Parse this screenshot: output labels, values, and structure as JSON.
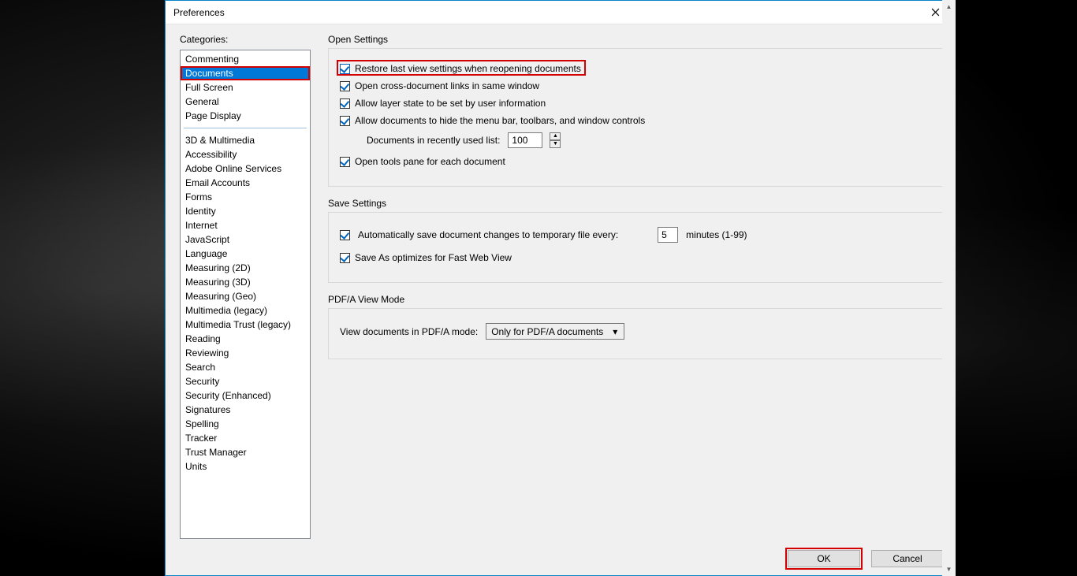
{
  "window": {
    "title": "Preferences"
  },
  "sidebar": {
    "label": "Categories:",
    "groups": [
      [
        "Commenting",
        "Documents",
        "Full Screen",
        "General",
        "Page Display"
      ],
      [
        "3D & Multimedia",
        "Accessibility",
        "Adobe Online Services",
        "Email Accounts",
        "Forms",
        "Identity",
        "Internet",
        "JavaScript",
        "Language",
        "Measuring (2D)",
        "Measuring (3D)",
        "Measuring (Geo)",
        "Multimedia (legacy)",
        "Multimedia Trust (legacy)",
        "Reading",
        "Reviewing",
        "Search",
        "Security",
        "Security (Enhanced)",
        "Signatures",
        "Spelling",
        "Tracker",
        "Trust Manager",
        "Units"
      ]
    ],
    "selected": "Documents"
  },
  "open_settings": {
    "title": "Open Settings",
    "restore_last_view": {
      "label": "Restore last view settings when reopening documents",
      "checked": true,
      "highlight": true
    },
    "cross_doc_links": {
      "label": "Open cross-document links in same window",
      "checked": true
    },
    "layer_state": {
      "label": "Allow layer state to be set by user information",
      "checked": true
    },
    "hide_menubar": {
      "label": "Allow documents to hide the menu bar, toolbars, and window controls",
      "checked": true
    },
    "recent_label": "Documents in recently used list:",
    "recent_value": "100",
    "tools_pane": {
      "label": "Open tools pane for each document",
      "checked": true
    }
  },
  "save_settings": {
    "title": "Save Settings",
    "autosave": {
      "label": "Automatically save document changes to temporary file every:",
      "checked": true,
      "value": "5",
      "suffix": "minutes (1-99)"
    },
    "fast_web": {
      "label": "Save As optimizes for Fast Web View",
      "checked": true
    }
  },
  "pdfa": {
    "title": "PDF/A View Mode",
    "label": "View documents in PDF/A mode:",
    "selected": "Only for PDF/A documents"
  },
  "buttons": {
    "ok": "OK",
    "cancel": "Cancel"
  },
  "highlights": {
    "ok_button": true,
    "documents_row": true
  }
}
